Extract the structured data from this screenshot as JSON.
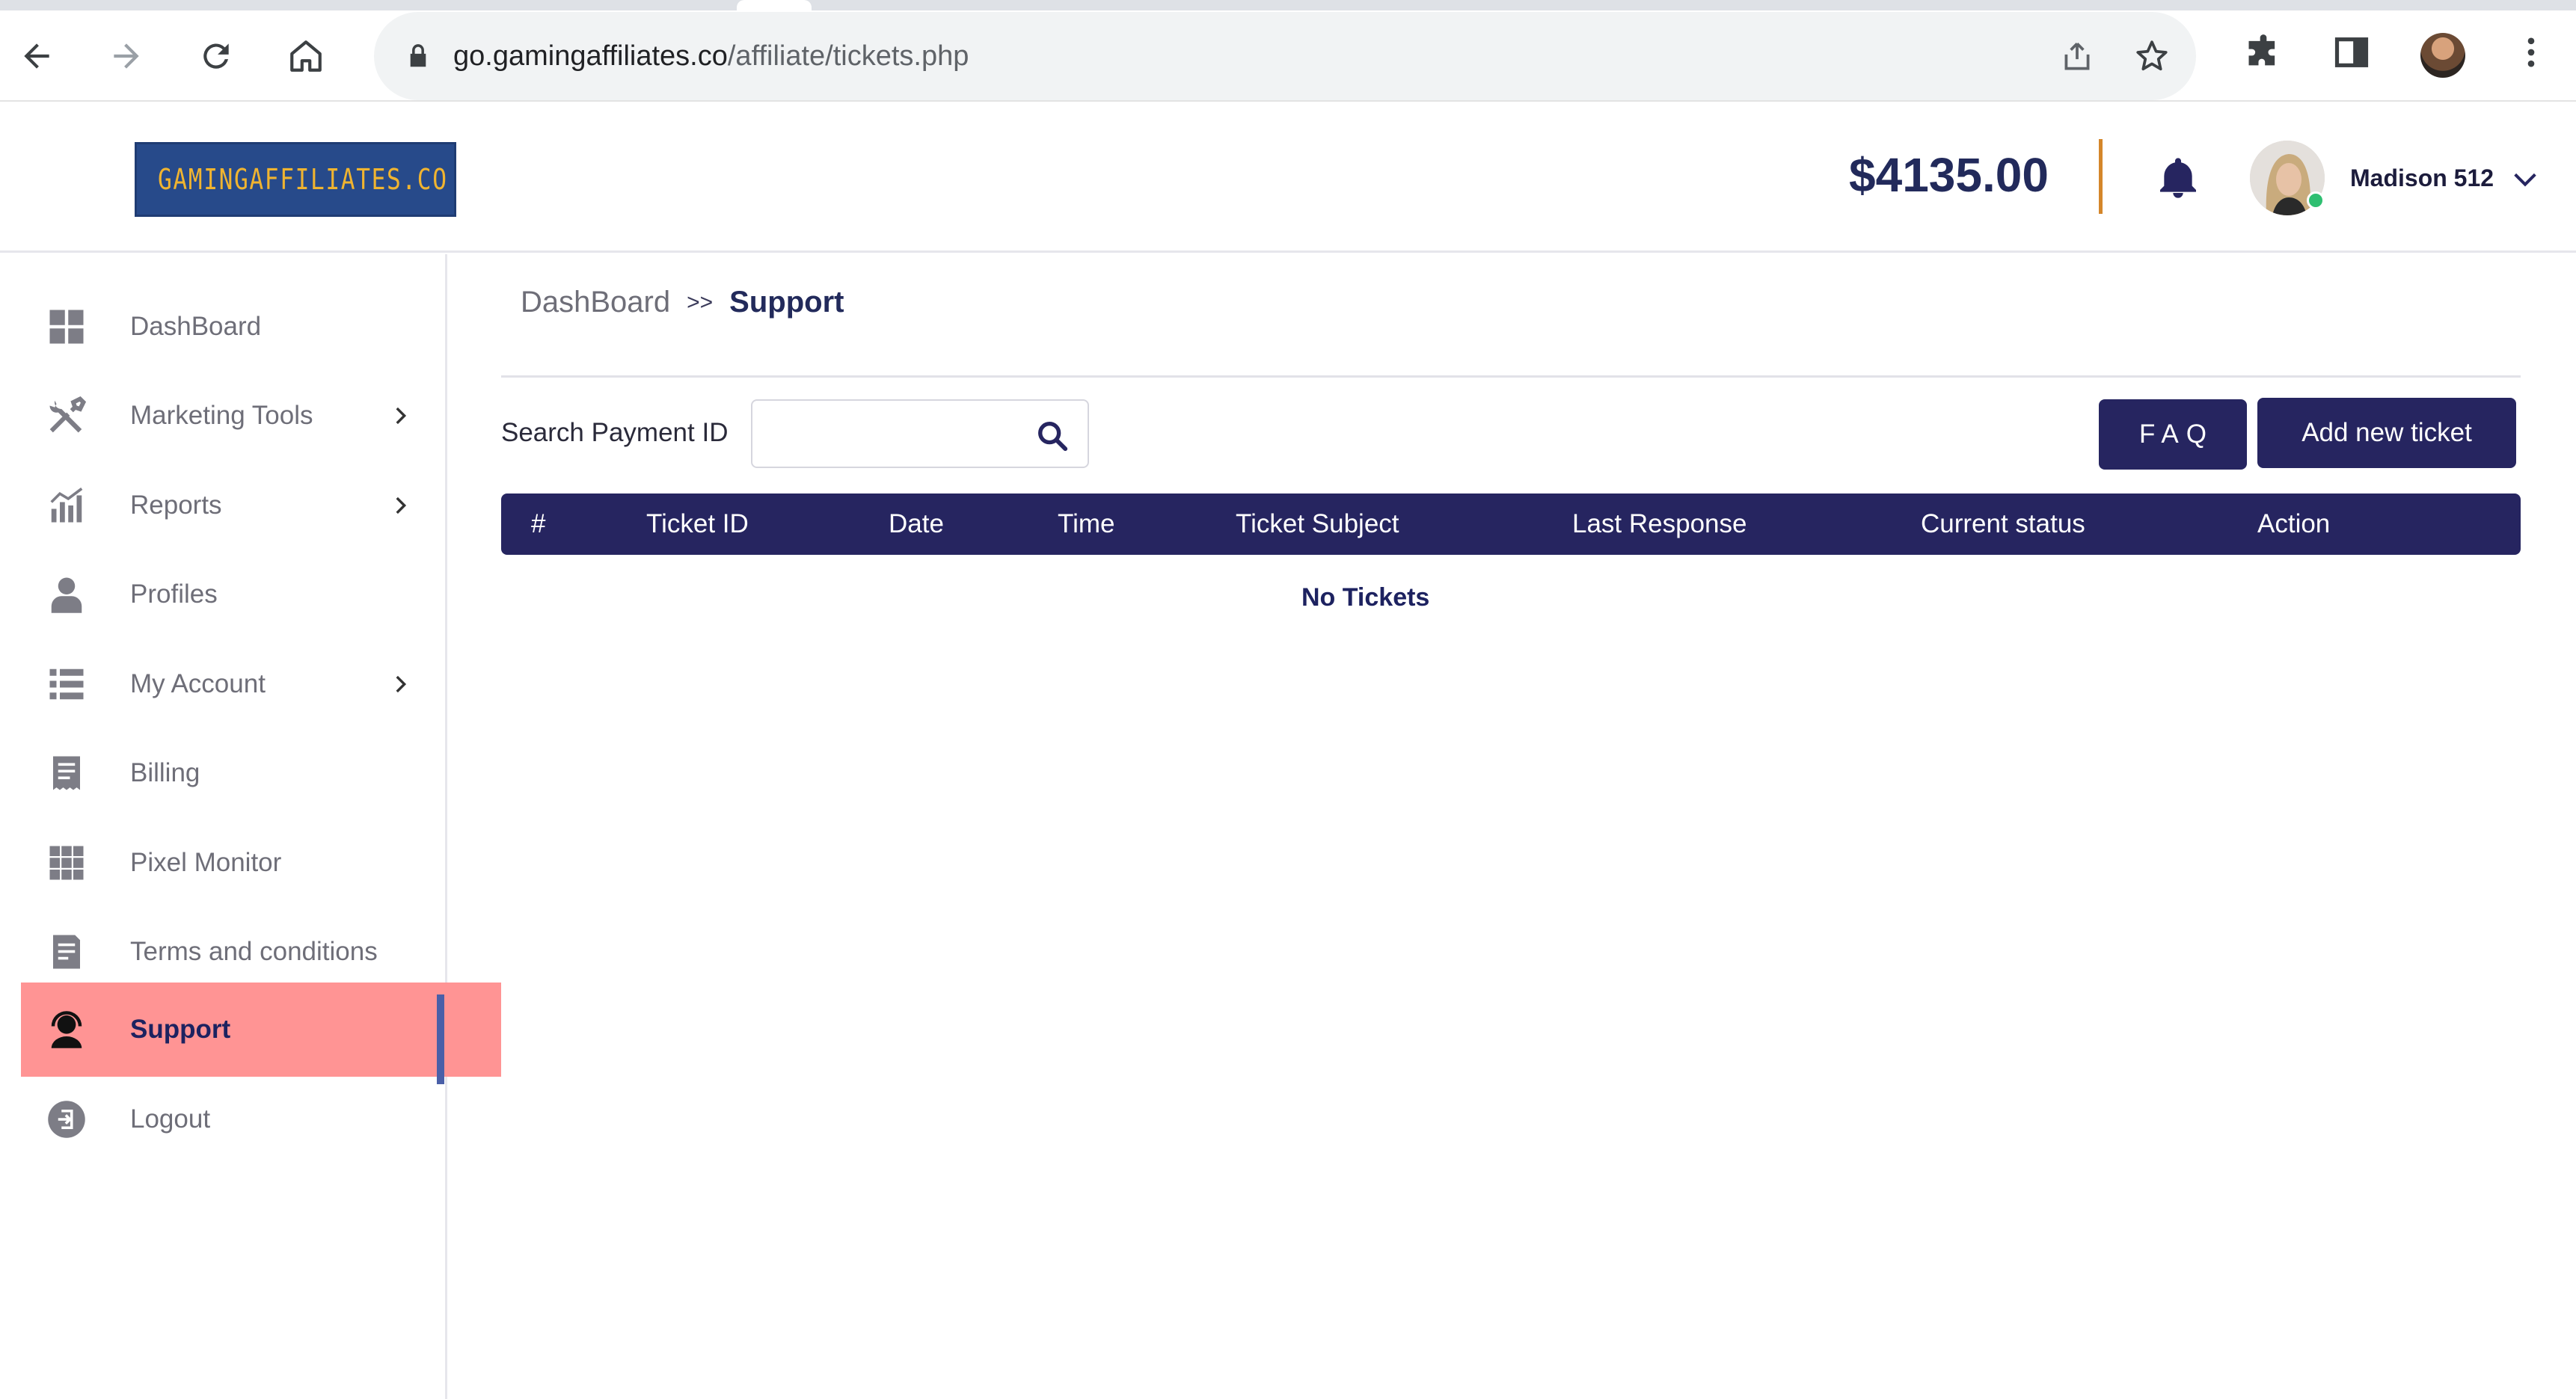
{
  "browser": {
    "url_host": "go.gamingaffiliates.co",
    "url_path": "/affiliate/tickets.php",
    "icons": [
      "back-arrow-icon",
      "forward-arrow-icon",
      "reload-icon",
      "home-icon",
      "lock-icon",
      "share-icon",
      "star-icon",
      "puzzle-icon",
      "side-panel-icon",
      "kebab-menu-icon"
    ]
  },
  "header": {
    "logo_text": "GAMINGAFFILIATES.CO",
    "balance": "$4135.00",
    "username": "Madison 512",
    "accent_color": "#d4862a",
    "brand_color": "#262560"
  },
  "sidebar": {
    "items": [
      {
        "label": "DashBoard",
        "icon": "dashboard-icon",
        "has_submenu": false
      },
      {
        "label": "Marketing Tools",
        "icon": "tools-icon",
        "has_submenu": true
      },
      {
        "label": "Reports",
        "icon": "chart-icon",
        "has_submenu": true
      },
      {
        "label": "Profiles",
        "icon": "user-icon",
        "has_submenu": false
      },
      {
        "label": "My Account",
        "icon": "list-icon",
        "has_submenu": true
      },
      {
        "label": "Billing",
        "icon": "receipt-icon",
        "has_submenu": false
      },
      {
        "label": "Pixel Monitor",
        "icon": "grid-icon",
        "has_submenu": false
      },
      {
        "label": "Terms and conditions",
        "icon": "document-icon",
        "has_submenu": false
      },
      {
        "label": "Support",
        "icon": "headset-icon",
        "has_submenu": false,
        "active": true
      },
      {
        "label": "Logout",
        "icon": "logout-icon",
        "has_submenu": false
      }
    ],
    "active_color": "#ff9494"
  },
  "main": {
    "breadcrumb": {
      "parent": "DashBoard",
      "separator": ">>",
      "current": "Support"
    },
    "search": {
      "label": "Search Payment ID",
      "value": "",
      "placeholder": ""
    },
    "buttons": {
      "faq": "FAQ",
      "add": "Add new ticket"
    },
    "table": {
      "columns": [
        "#",
        "Ticket ID",
        "Date",
        "Time",
        "Ticket Subject",
        "Last Response",
        "Current status",
        "Action"
      ],
      "rows": [],
      "empty_text": "No Tickets"
    }
  }
}
